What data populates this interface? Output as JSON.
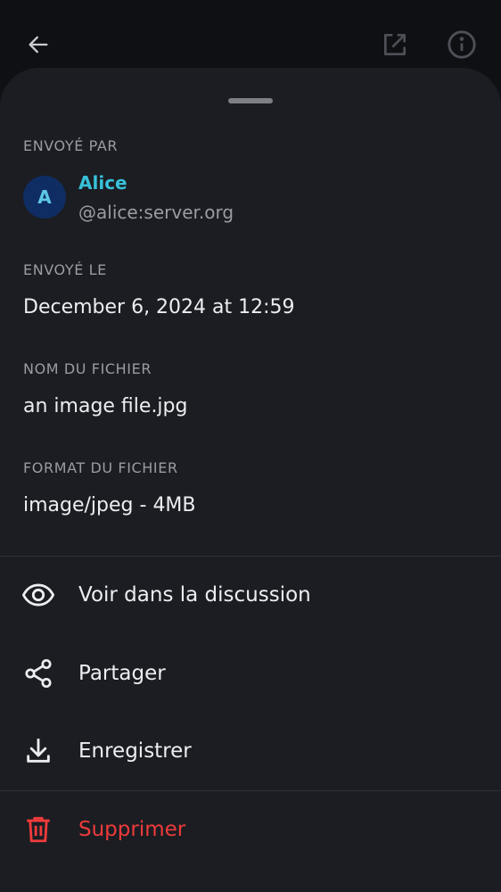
{
  "topbar": {
    "back_icon": "arrow-left-icon",
    "open_external_icon": "open-external-icon",
    "info_icon": "info-icon"
  },
  "sender": {
    "label": "ENVOYÉ PAR",
    "avatar_letter": "A",
    "name": "Alice",
    "user_id": "@alice:server.org"
  },
  "sent_date": {
    "label": "ENVOYÉ LE",
    "value": "December 6, 2024 at 12:59"
  },
  "file_name": {
    "label": "NOM DU FICHIER",
    "value": "an image file.jpg"
  },
  "file_format": {
    "label": "FORMAT DU FICHIER",
    "value": "image/jpeg - 4MB"
  },
  "actions": [
    {
      "label": "Voir dans la discussion",
      "icon": "eye-icon"
    },
    {
      "label": "Partager",
      "icon": "share-icon"
    },
    {
      "label": "Enregistrer",
      "icon": "download-icon"
    },
    {
      "label": "Supprimer",
      "icon": "trash-icon"
    }
  ],
  "colors": {
    "accent": "#38c0d9",
    "danger": "#ef3b3b",
    "sheet_bg": "#1b1d22"
  }
}
